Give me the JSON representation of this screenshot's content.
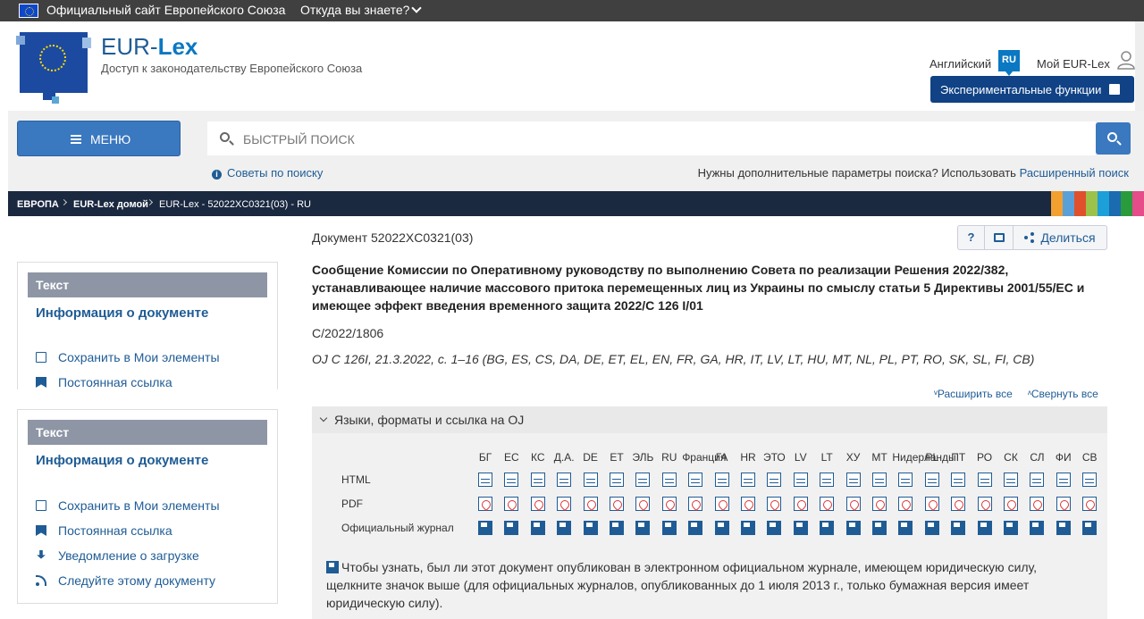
{
  "eu_bar": {
    "title": "Официальный сайт Европейского Союза",
    "how_to_know": "Откуда вы знаете?"
  },
  "header": {
    "brand_prefix": "EUR-",
    "brand_suffix": "Lex",
    "subtitle": "Доступ к законодательству Европейского Союза",
    "language_label": "Английский",
    "language_code": "RU",
    "my_eurlex": "Мой EUR-Lex",
    "experimental": "Экспериментальные функции"
  },
  "search": {
    "menu_label": "МЕНЮ",
    "placeholder": "БЫСТРЫЙ ПОИСК",
    "tips": "Советы по поиску",
    "advanced_prompt": "Нужны дополнительные параметры поиска? Использовать",
    "advanced_link": "Расширенный поиск"
  },
  "breadcrumb": {
    "items": [
      "ЕВРОПА",
      "EUR-Lex домой",
      "EUR-Lex - 52022XC0321(03) - RU"
    ],
    "stripe_colors": [
      "#f2a030",
      "#5aa0d8",
      "#e0502c",
      "#9cc24a",
      "#1d9fd8",
      "#1b6bb0",
      "#2a9b3c",
      "#e64b8a"
    ]
  },
  "sidebar": {
    "panel1": {
      "title": "Текст",
      "info": "Информация о документе",
      "items": [
        "Сохранить в Мои элементы",
        "Постоянная ссылка"
      ]
    },
    "panel2": {
      "title": "Текст",
      "info": "Информация о документе",
      "items": [
        "Сохранить в Мои элементы",
        "Постоянная ссылка",
        "Уведомление о загрузке",
        "Следуйте этому документу"
      ]
    }
  },
  "document": {
    "id_label": "Документ 52022XC0321(03)",
    "help": "?",
    "share": "Делиться",
    "title": "Сообщение Комиссии по Оперативному руководству по выполнению Совета по реализации Решения 2022/382, устанавливающее наличие массового притока перемещенных лиц из Украины по смыслу статьи 5 Директивы 2001/55/EC и имеющее эффект введения временного защита 2022/C 126 I/01",
    "code": "C/2022/1806",
    "oj_ref": "OJ C 126I, 21.3.2022, с. 1–16 (BG, ES, CS, DA, DE, ET, EL, EN, FR, GA, HR, IT, LV, LT, HU, MT, NL, PL, PT, RO, SK, SL, FI, CB)",
    "expand_all": "Расширить все",
    "collapse_all": "Свернуть все"
  },
  "languages": {
    "section_title": "Языки, форматы и ссылка на OJ",
    "columns": [
      "БГ",
      "ЕС",
      "КС",
      "Д.А.",
      "DE",
      "ЕТ",
      "ЭЛЬ",
      "RU",
      "Франция",
      "ГА",
      "HR",
      "ЭТО",
      "LV",
      "LT",
      "ХУ",
      "МТ",
      "Нидерланды",
      "PL",
      "ПТ",
      "РО",
      "СК",
      "СЛ",
      "ФИ",
      "СВ"
    ],
    "rows": [
      "HTML",
      "PDF",
      "Официальный журнал"
    ],
    "notice": "Чтобы узнать, был ли этот документ опубликован в электронном официальном журнале, имеющем юридическую силу, щелкните значок выше (для официальных журналов, опубликованных до 1 июля 2013 г., только бумажная версия имеет юридическую силу)."
  }
}
